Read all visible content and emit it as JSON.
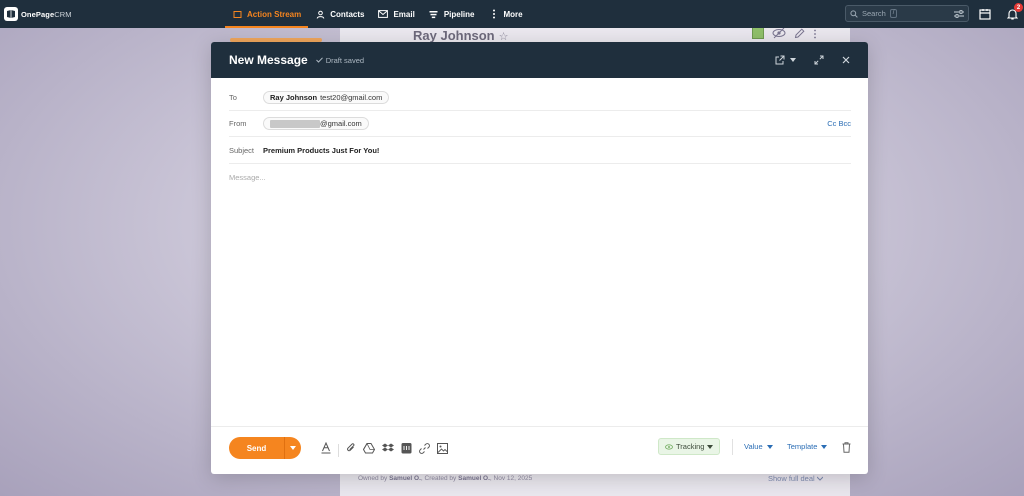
{
  "app": {
    "logo_bold": "OnePage",
    "logo_light": "CRM"
  },
  "nav": {
    "items": [
      {
        "label": "Action Stream",
        "icon": "stream-icon",
        "active": true
      },
      {
        "label": "Contacts",
        "icon": "person-icon",
        "active": false
      },
      {
        "label": "Email",
        "icon": "envelope-icon",
        "active": false
      },
      {
        "label": "Pipeline",
        "icon": "funnel-icon",
        "active": false
      },
      {
        "label": "More",
        "icon": "more-vertical-icon",
        "active": false
      }
    ],
    "search_placeholder": "Search",
    "search_shortcut": "/",
    "notification_count": "2"
  },
  "background": {
    "contact_name": "Ray Johnson",
    "footer_prefix": "Owned by",
    "owner": "Samuel O.",
    "created_by_label": ", Created by",
    "creator": "Samuel O.",
    "created_date": ", Nov 12, 2025",
    "show_full_deal": "Show full deal"
  },
  "compose": {
    "title": "New Message",
    "draft_status": "Draft saved",
    "to_label": "To",
    "to_name": "Ray Johnson",
    "to_email": "test20@gmail.com",
    "from_label": "From",
    "from_email_suffix": "@gmail.com",
    "cc_bcc": "Cc Bcc",
    "subject_label": "Subject",
    "subject_value": "Premium Products Just For You!",
    "message_placeholder": "Message..."
  },
  "footer": {
    "send_label": "Send",
    "tracking_label": "Tracking",
    "value_label": "Value",
    "template_label": "Template"
  },
  "colors": {
    "nav_bg": "#1f2f3d",
    "accent": "#f5851f",
    "link": "#2a6db5"
  }
}
